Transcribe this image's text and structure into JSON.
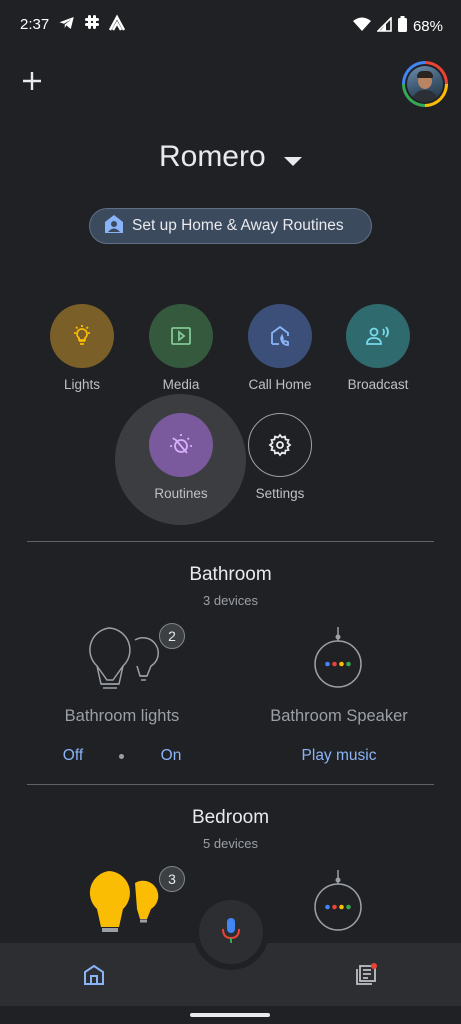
{
  "status": {
    "time": "2:37",
    "battery": "68%"
  },
  "header": {
    "home_name": "Romero"
  },
  "setup_pill": {
    "label": "Set up Home & Away Routines"
  },
  "shortcuts": [
    {
      "label": "Lights",
      "color": "#7a5f28",
      "icon": "lightbulb-icon"
    },
    {
      "label": "Media",
      "color": "#35593d",
      "icon": "media-icon"
    },
    {
      "label": "Call Home",
      "color": "#3b4f78",
      "icon": "call-home-icon"
    },
    {
      "label": "Broadcast",
      "color": "#2f6a6e",
      "icon": "broadcast-icon"
    },
    {
      "label": "Routines",
      "color": "#7a5a9c",
      "icon": "routines-icon"
    },
    {
      "label": "Settings",
      "color": "#202124",
      "icon": "gear-icon"
    }
  ],
  "rooms": [
    {
      "name": "Bathroom",
      "count": "3 devices",
      "lights": {
        "name": "Bathroom lights",
        "badge": "2",
        "off": "Off",
        "on": "On"
      },
      "speaker": {
        "name": "Bathroom Speaker",
        "action": "Play music"
      }
    },
    {
      "name": "Bedroom",
      "count": "5 devices",
      "lights": {
        "badge": "3"
      }
    }
  ],
  "colors": {
    "accent": "#8ab4f8",
    "bulb_on": "#fbbc04"
  }
}
